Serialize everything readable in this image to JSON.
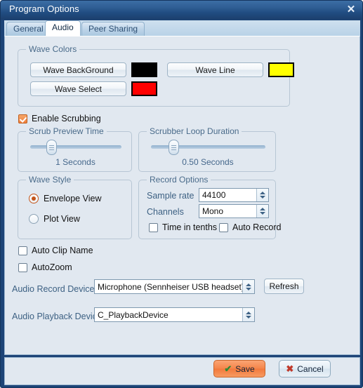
{
  "window": {
    "title": "Program Options",
    "close_icon": "close-icon",
    "close_glyph": "✕"
  },
  "tabs": [
    {
      "label": "General",
      "active": false
    },
    {
      "label": "Audio",
      "active": true
    },
    {
      "label": "Peer Sharing",
      "active": false
    }
  ],
  "wave_colors": {
    "group_title": "Wave Colors",
    "wave_background": {
      "label": "Wave BackGround",
      "color": "#000000"
    },
    "wave_line": {
      "label": "Wave Line",
      "color": "#ffff00"
    },
    "wave_select": {
      "label": "Wave Select",
      "color": "#ff0000"
    }
  },
  "enable_scrubbing": {
    "label": "Enable Scrubbing",
    "checked": true
  },
  "scrub_preview_time": {
    "group_title": "Scrub Preview Time",
    "value_text": "1 Seconds",
    "thumb_percent": 23
  },
  "scrubber_loop_duration": {
    "group_title": "Scrubber Loop Duration",
    "value_text": "0.50 Seconds",
    "thumb_percent": 23
  },
  "wave_style": {
    "group_title": "Wave Style",
    "options": [
      {
        "label": "Envelope View",
        "selected": true
      },
      {
        "label": "Plot View",
        "selected": false
      }
    ]
  },
  "record_options": {
    "group_title": "Record Options",
    "sample_rate": {
      "label": "Sample rate",
      "value": "44100"
    },
    "channels": {
      "label": "Channels",
      "value": "Mono"
    },
    "time_in_tenths": {
      "label": "Time in tenths",
      "checked": false
    },
    "auto_record": {
      "label": "Auto Record",
      "checked": false
    }
  },
  "auto_clip_name": {
    "label": "Auto Clip Name",
    "checked": false
  },
  "auto_zoom": {
    "label": "AutoZoom",
    "checked": false
  },
  "audio_record_device": {
    "label": "Audio Record Device",
    "value": "Microphone (Sennheiser USB headset)"
  },
  "refresh_button": {
    "label": "Refresh"
  },
  "audio_playback_device": {
    "label": "Audio Playback Device",
    "value": "C_PlaybackDevice"
  },
  "footer": {
    "save": {
      "label": "Save",
      "icon": "check-icon",
      "glyph": "✔",
      "color": "#f2793c"
    },
    "cancel": {
      "label": "Cancel",
      "icon": "x-icon",
      "glyph": "✖",
      "color": "#c0392b"
    }
  }
}
